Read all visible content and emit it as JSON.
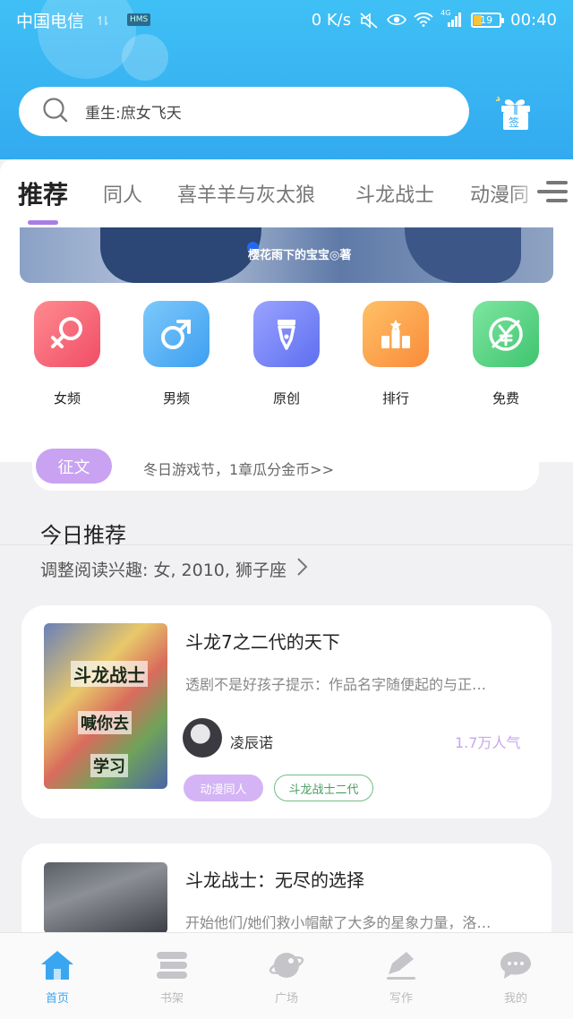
{
  "status_bar": {
    "carrier": "中国电信",
    "hms_badge": "HMS",
    "net_speed": "0 K/s",
    "network_type": "4G",
    "battery": "19",
    "time": "00:40"
  },
  "search": {
    "placeholder": "重生:庶女飞天",
    "icon": "search-icon"
  },
  "header": {
    "gift_label": "签",
    "accent": "#3fb8f5"
  },
  "tabs": [
    {
      "label": "推荐",
      "active": true
    },
    {
      "label": "同人"
    },
    {
      "label": "喜羊羊与灰太狼"
    },
    {
      "label": "斗龙战士"
    },
    {
      "label": "动漫同"
    }
  ],
  "banner": {
    "author": "樱花雨下的宝宝◎著"
  },
  "categories": [
    {
      "label": "女频",
      "icon": "female-icon",
      "color": "#f45d6f"
    },
    {
      "label": "男频",
      "icon": "male-icon",
      "color": "#4aa9f0"
    },
    {
      "label": "原创",
      "icon": "pen-nib-icon",
      "color": "#6f7cf0"
    },
    {
      "label": "排行",
      "icon": "podium-icon",
      "color": "#fba34b"
    },
    {
      "label": "免费",
      "icon": "yen-icon",
      "color": "#4fcf80"
    }
  ],
  "notice": {
    "tag": "征文",
    "text": "冬日游戏节，1章瓜分金币>>"
  },
  "recommend": {
    "title": "今日推荐",
    "interest": "调整阅读兴趣: 女, 2010, 狮子座"
  },
  "books": [
    {
      "title": "斗龙7之二代的天下",
      "desc": "透剧不是好孩子提示：作品名字随便起的与正…",
      "author": "凌辰诺",
      "popularity": "1.7万人气",
      "tags": [
        "动漫同人",
        "斗龙战士二代"
      ],
      "cover_text": [
        "斗龙战士",
        "喊你去",
        "学习"
      ]
    },
    {
      "title": "斗龙战士：无尽的选择",
      "desc": "开始他们/她们救小帽献了大多的星象力量，洛…"
    }
  ],
  "bottom_nav": [
    {
      "label": "首页",
      "icon": "home-icon",
      "active": true
    },
    {
      "label": "书架",
      "icon": "bookshelf-icon"
    },
    {
      "label": "广场",
      "icon": "planet-icon"
    },
    {
      "label": "写作",
      "icon": "write-icon"
    },
    {
      "label": "我的",
      "icon": "chat-bubble-icon"
    }
  ]
}
